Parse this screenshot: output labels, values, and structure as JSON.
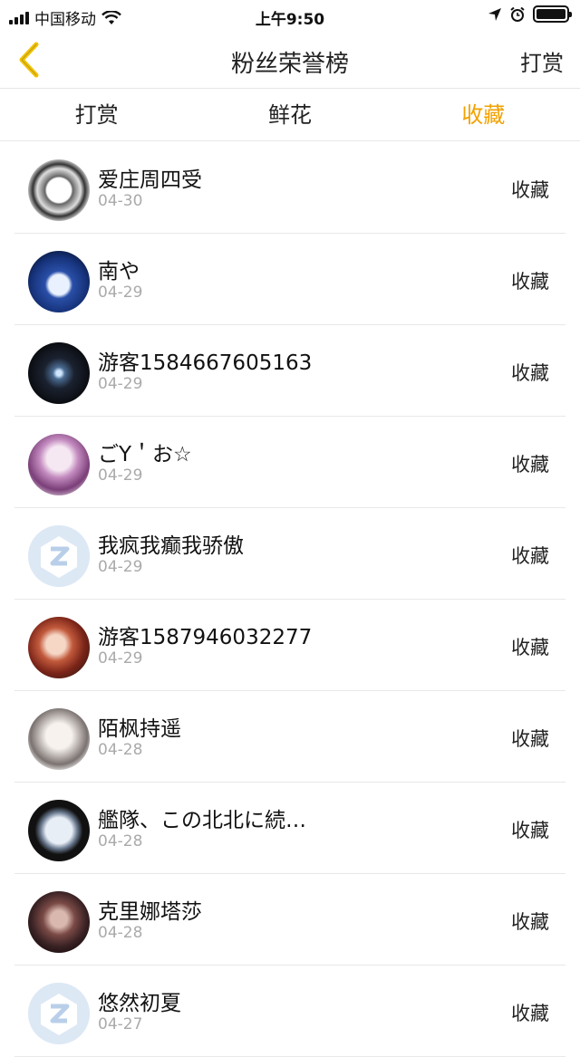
{
  "status": {
    "carrier": "中国移动",
    "time": "上午9:50"
  },
  "nav": {
    "title": "粉丝荣誉榜",
    "action_label": "打赏"
  },
  "tabs": [
    {
      "label": "打赏",
      "active": false
    },
    {
      "label": "鲜花",
      "active": false
    },
    {
      "label": "收藏",
      "active": true
    }
  ],
  "colors": {
    "accent": "#f2a100",
    "back_arrow": "#f2c200"
  },
  "items": [
    {
      "name": "爱庄周四受",
      "date": "04-30",
      "action": "收藏"
    },
    {
      "name": "南や",
      "date": "04-29",
      "action": "收藏"
    },
    {
      "name": "游客1584667605163",
      "date": "04-29",
      "action": "收藏"
    },
    {
      "name": "ごY＇お☆",
      "date": "04-29",
      "action": "收藏"
    },
    {
      "name": "我疯我癫我骄傲",
      "date": "04-29",
      "action": "收藏"
    },
    {
      "name": "游客1587946032277",
      "date": "04-29",
      "action": "收藏"
    },
    {
      "name": "陌枫持遥",
      "date": "04-28",
      "action": "收藏"
    },
    {
      "name": "艦隊、この北北に続…",
      "date": "04-28",
      "action": "收藏"
    },
    {
      "name": "克里娜塔莎",
      "date": "04-28",
      "action": "收藏"
    },
    {
      "name": "悠然初夏",
      "date": "04-27",
      "action": "收藏"
    }
  ]
}
